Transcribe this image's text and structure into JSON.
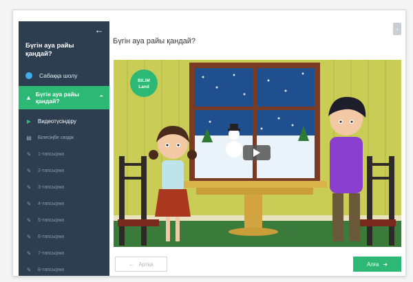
{
  "sidebar": {
    "back_icon": "arrow-left-icon",
    "title": "Бүгін ауа райы қандай?",
    "overview_label": "Сабаққа шолу",
    "active_lesson_label": "Бүгін ауа райы қандай?",
    "items": [
      {
        "label": "Видеотүсіндіру",
        "icon": "play-icon"
      },
      {
        "label": "Білесіңбе сөздік",
        "icon": "book-icon"
      },
      {
        "label": "1-тапсырма",
        "icon": "edit-icon"
      },
      {
        "label": "2-тапсырма",
        "icon": "edit-icon"
      },
      {
        "label": "3-тапсырма",
        "icon": "edit-icon"
      },
      {
        "label": "4-тапсырма",
        "icon": "edit-icon"
      },
      {
        "label": "5-тапсырма",
        "icon": "edit-icon"
      },
      {
        "label": "6-тапсырма",
        "icon": "edit-icon"
      },
      {
        "label": "7-тапсырма",
        "icon": "edit-icon"
      },
      {
        "label": "8-тапсырма",
        "icon": "edit-icon"
      }
    ]
  },
  "main": {
    "title": "Бүгін ауа райы қандай?"
  },
  "video": {
    "logo_line1": "BILIM",
    "logo_line2": "Land"
  },
  "nav": {
    "back_label": "Артқа",
    "next_label": "Алға"
  },
  "colors": {
    "sidebar_bg": "#2c3e50",
    "accent_green": "#2eb876",
    "overview_dot": "#3daee9"
  }
}
